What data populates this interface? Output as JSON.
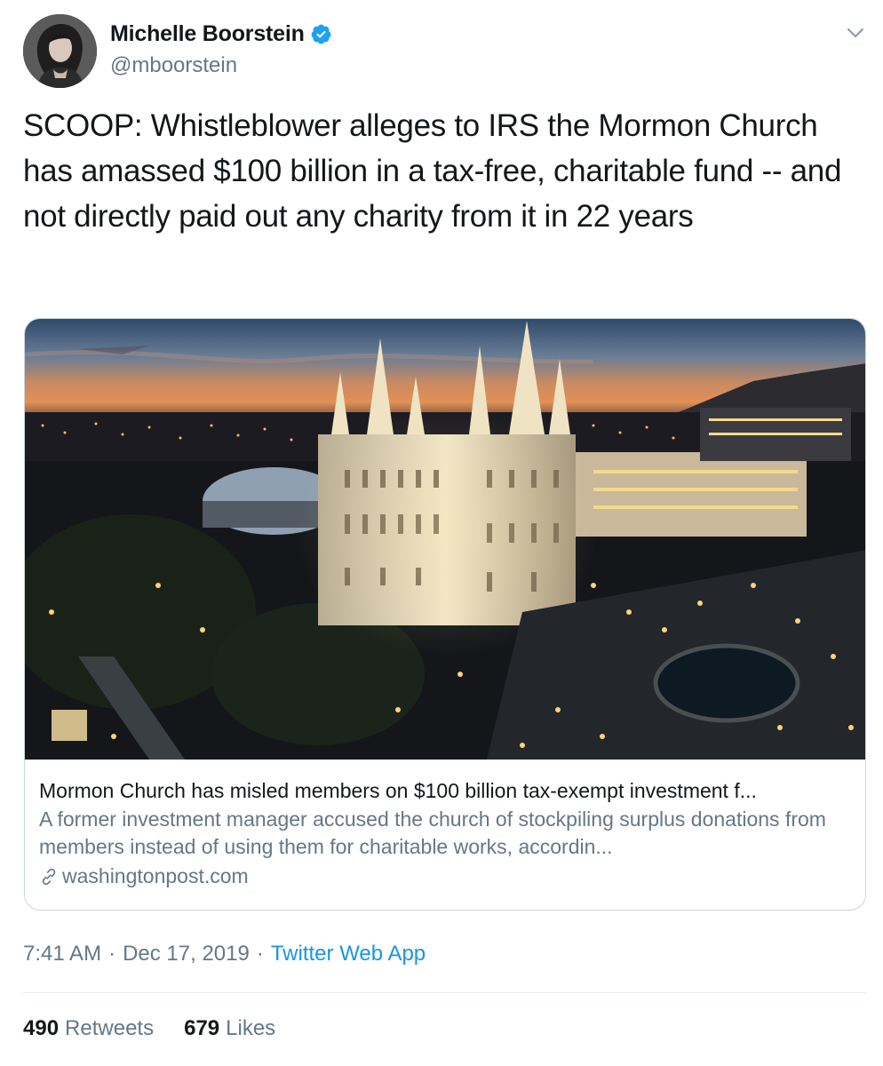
{
  "author": {
    "display_name": "Michelle Boorstein",
    "handle": "@mboorstein",
    "verified": true
  },
  "tweet": {
    "text": "SCOOP: Whistleblower alleges to IRS the Mormon Church has amassed $100 billion in a tax-free, charitable fund -- and not directly paid out any charity from it in 22 years"
  },
  "card": {
    "title": "Mormon Church has misled members on $100 billion tax-exempt investment f...",
    "description": "A former investment manager accused the church of stockpiling surplus donations from members instead of using them for charitable works, accordin...",
    "domain": "washingtonpost.com"
  },
  "meta": {
    "time": "7:41 AM",
    "separator": "·",
    "date": "Dec 17, 2019",
    "source": "Twitter Web App"
  },
  "stats": {
    "retweets_count": "490",
    "retweets_label": "Retweets",
    "likes_count": "679",
    "likes_label": "Likes"
  },
  "colors": {
    "text": "#14171a",
    "secondary": "#657786",
    "link": "#1b95e0",
    "verified": "#1da1f2",
    "border": "#ccd6dd"
  },
  "icons": {
    "verified": "verified-badge-icon",
    "caret": "chevron-down-icon",
    "link": "link-icon"
  }
}
